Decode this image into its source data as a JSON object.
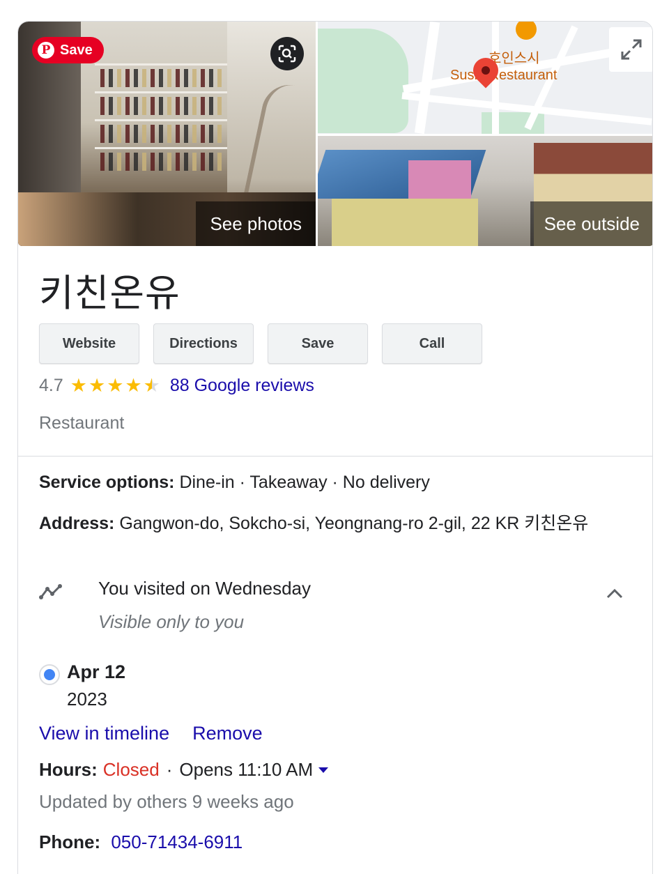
{
  "pinterest": {
    "save_label": "Save"
  },
  "media": {
    "photos_label": "See photos",
    "outside_label": "See outside",
    "map_label_ko": "호인스시",
    "map_label_en": "Sushi Restaurant"
  },
  "place": {
    "name": "키친온유",
    "category": "Restaurant"
  },
  "actions": {
    "website": "Website",
    "directions": "Directions",
    "save": "Save",
    "call": "Call"
  },
  "rating": {
    "value": "4.7",
    "stars": 4.5,
    "reviews_link": "88 Google reviews"
  },
  "service": {
    "label": "Service options:",
    "value": "Dine-in · Takeaway · No delivery"
  },
  "address": {
    "label": "Address:",
    "value": "Gangwon-do, Sokcho-si, Yeongnang-ro 2-gil, 22 KR 키친온유"
  },
  "visit": {
    "text": "You visited on Wednesday",
    "privacy": "Visible only to you",
    "date": "Apr 12",
    "year": "2023",
    "timeline_link": "View in timeline",
    "remove_link": "Remove"
  },
  "hours": {
    "label": "Hours:",
    "status": "Closed",
    "sep": "·",
    "opens": "Opens 11:10 AM",
    "updated": "Updated by others 9 weeks ago"
  },
  "phone": {
    "label": "Phone:",
    "number": "050-71434-6911"
  },
  "colors": {
    "link": "#1a0dab",
    "closed": "#d93025",
    "star": "#fbbc04",
    "pinterest": "#e60023"
  }
}
